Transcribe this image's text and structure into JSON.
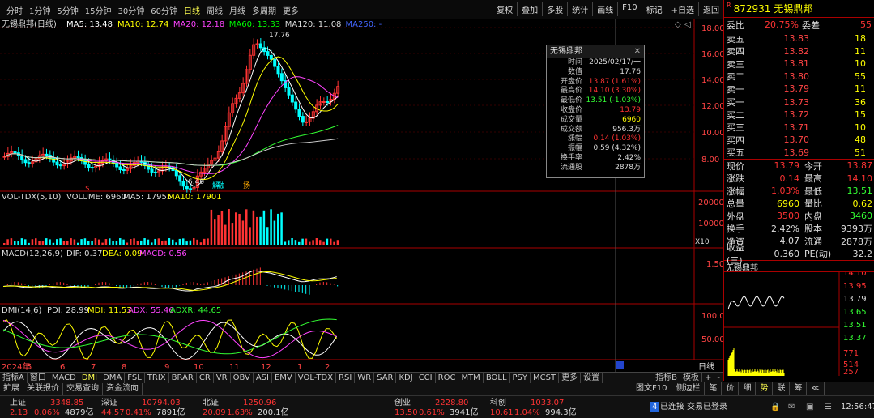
{
  "topbar": {
    "periods": [
      "分时",
      "1分钟",
      "5分钟",
      "15分钟",
      "30分钟",
      "60分钟",
      "日线",
      "周线",
      "月线",
      "多周期",
      "更多"
    ],
    "selected_period": "日线",
    "tools": [
      "复权",
      "叠加",
      "多股",
      "统计",
      "画线",
      "F10",
      "标记",
      "+自选",
      "返回"
    ]
  },
  "stock": {
    "code": "872931",
    "name": "无锡鼎邦",
    "marker": "R"
  },
  "main": {
    "legend_title": "无锡鼎邦(日线)",
    "ma": [
      {
        "label": "MA5: 13.48",
        "color": "#ffffff"
      },
      {
        "label": "MA10: 12.74",
        "color": "#ffff00"
      },
      {
        "label": "MA20: 12.18",
        "color": "#ff44ff"
      },
      {
        "label": "MA60: 13.33",
        "color": "#00ff00"
      },
      {
        "label": "MA120: 11.08",
        "color": "#dddddd"
      },
      {
        "label": "MA250: -",
        "color": "#4466ff"
      }
    ],
    "high_label": "17.76",
    "low_label": "6.46",
    "tag1": "$",
    "tag2": "解",
    "tag3": "融",
    "tag4": "扬"
  },
  "popup": {
    "title": "无锡鼎邦",
    "close": "✕",
    "rows": [
      {
        "k": "时间",
        "v": "2025/02/17/一",
        "c": "#ddd"
      },
      {
        "k": "数值",
        "v": "17.76",
        "c": "#ddd"
      },
      {
        "k": "开盘价",
        "v": "13.87 (1.61%)",
        "c": "#f33"
      },
      {
        "k": "最高价",
        "v": "14.10 (3.30%)",
        "c": "#f33"
      },
      {
        "k": "最低价",
        "v": "13.51 (-1.03%)",
        "c": "#3f3"
      },
      {
        "k": "收盘价",
        "v": "13.79",
        "c": "#f33"
      },
      {
        "k": "成交量",
        "v": "6960",
        "c": "#ff0"
      },
      {
        "k": "成交额",
        "v": "956.3万",
        "c": "#ddd"
      },
      {
        "k": "涨幅",
        "v": "0.14 (1.03%)",
        "c": "#f33"
      },
      {
        "k": "振幅",
        "v": "0.59 (4.32%)",
        "c": "#ddd"
      },
      {
        "k": "换手率",
        "v": "2.42%",
        "c": "#ddd"
      },
      {
        "k": "流通股",
        "v": "2878万",
        "c": "#ddd"
      }
    ]
  },
  "yaxis": {
    "main": [
      "18.00",
      "16.00",
      "14.00",
      "12.00",
      "10.00",
      "8.00"
    ],
    "vol": [
      "20000",
      "10000"
    ],
    "vol_unit": "X10",
    "macd": [
      "1.50"
    ],
    "dmi": [
      "100.0",
      "50.00"
    ],
    "period": "日线"
  },
  "xaxis": [
    "2024年",
    "5",
    "6",
    "7",
    "8",
    "9",
    "10",
    "11",
    "12",
    "1",
    "2"
  ],
  "vol": {
    "label": "VOL-TDX(5,10)",
    "v1": "VOLUME: 6960",
    "v2": "MA5: 17955",
    "v3": "MA10: 17901"
  },
  "macd": {
    "label": "MACD(12,26,9)",
    "v1": "DIF: 0.37",
    "v2": "DEA: 0.09",
    "v3": "MACD: 0.56"
  },
  "dmi": {
    "label": "DMI(14,6)",
    "v1": "PDI: 28.99",
    "v2": "MDI: 11.53",
    "v3": "ADX: 55.46",
    "v4": "ADXR: 44.65"
  },
  "indicators": [
    "指标A",
    "窗口",
    "MACD",
    "DMI",
    "DMA",
    "FSL",
    "TRIX",
    "BRAR",
    "CR",
    "VR",
    "OBV",
    "ASI",
    "EMV",
    "VOL-TDX",
    "RSI",
    "WR",
    "SAR",
    "KDJ",
    "CCI",
    "ROC",
    "MTM",
    "BOLL",
    "PSY",
    "MCST",
    "更多",
    "设置"
  ],
  "selected_indicator": "DMI",
  "indicator_right": [
    "指标B",
    "模板",
    "+",
    "-"
  ],
  "subtabs": [
    "扩展",
    "关联报价",
    "交易查询",
    "资金流向"
  ],
  "orderbook": {
    "ratio": {
      "k1": "委比",
      "v1": "20.75%",
      "k2": "委差",
      "v2": "55"
    },
    "asks": [
      {
        "l": "卖五",
        "p": "13.83",
        "v": "18"
      },
      {
        "l": "卖四",
        "p": "13.82",
        "v": "11"
      },
      {
        "l": "卖三",
        "p": "13.81",
        "v": "10"
      },
      {
        "l": "卖二",
        "p": "13.80",
        "v": "55"
      },
      {
        "l": "卖一",
        "p": "13.79",
        "v": "11"
      }
    ],
    "bids": [
      {
        "l": "买一",
        "p": "13.73",
        "v": "36"
      },
      {
        "l": "买二",
        "p": "13.72",
        "v": "15"
      },
      {
        "l": "买三",
        "p": "13.71",
        "v": "10"
      },
      {
        "l": "买四",
        "p": "13.70",
        "v": "48"
      },
      {
        "l": "买五",
        "p": "13.69",
        "v": "51"
      }
    ]
  },
  "quote": [
    {
      "k1": "现价",
      "v1": "13.79",
      "c1": "#f33",
      "k2": "今开",
      "v2": "13.87",
      "c2": "#f33"
    },
    {
      "k1": "涨跌",
      "v1": "0.14",
      "c1": "#f33",
      "k2": "最高",
      "v2": "14.10",
      "c2": "#f33"
    },
    {
      "k1": "涨幅",
      "v1": "1.03%",
      "c1": "#f33",
      "k2": "最低",
      "v2": "13.51",
      "c2": "#3f3"
    },
    {
      "k1": "总量",
      "v1": "6960",
      "c1": "#ff0",
      "k2": "量比",
      "v2": "0.62",
      "c2": "#ff0"
    },
    {
      "k1": "外盘",
      "v1": "3500",
      "c1": "#f33",
      "k2": "内盘",
      "v2": "3460",
      "c2": "#3f3"
    },
    {
      "k1": "换手",
      "v1": "2.42%",
      "c1": "#ddd",
      "k2": "股本",
      "v2": "9393万",
      "c2": "#ddd"
    },
    {
      "k1": "净资",
      "v1": "4.07",
      "c1": "#ddd",
      "k2": "流通",
      "v2": "2878万",
      "c2": "#ddd"
    },
    {
      "k1": "收益(三)",
      "v1": "0.360",
      "c1": "#ddd",
      "k2": "PE(动)",
      "v2": "32.2",
      "c2": "#ddd"
    }
  ],
  "mini": {
    "title": "无锡鼎邦",
    "y": [
      "14.10",
      "13.95",
      "13.79",
      "13.65",
      "13.51",
      "13.37",
      "771",
      "514",
      "257"
    ]
  },
  "rtabs": [
    "图文F10",
    "侧边栏",
    "笔",
    "价",
    "细",
    "势",
    "联",
    "筹",
    "≪"
  ],
  "selected_rtab": "势",
  "status": {
    "idx": [
      {
        "n": "上证",
        "v": "3348.85",
        "c": "2.13",
        "p": "0.06%",
        "a": "4879亿",
        "cl": "#f33"
      },
      {
        "n": "深证",
        "v": "10794.03",
        "c": "44.57",
        "p": "0.41%",
        "a": "7891亿",
        "cl": "#f33"
      },
      {
        "n": "北证",
        "v": "1250.96",
        "c": "20.09",
        "p": "1.63%",
        "a": "200.1亿",
        "cl": "#f33"
      },
      {
        "n": "创业",
        "v": "2228.80",
        "c": "13.50",
        "p": "0.61%",
        "a": "3941亿",
        "cl": "#f33"
      },
      {
        "n": "科创",
        "v": "1033.07",
        "c": "10.61",
        "p": "1.04%",
        "a": "994.3亿",
        "cl": "#f33"
      }
    ],
    "conn": "已连接",
    "trade": "交易已登录",
    "time": "12:56:47",
    "conn_num": "4"
  }
}
